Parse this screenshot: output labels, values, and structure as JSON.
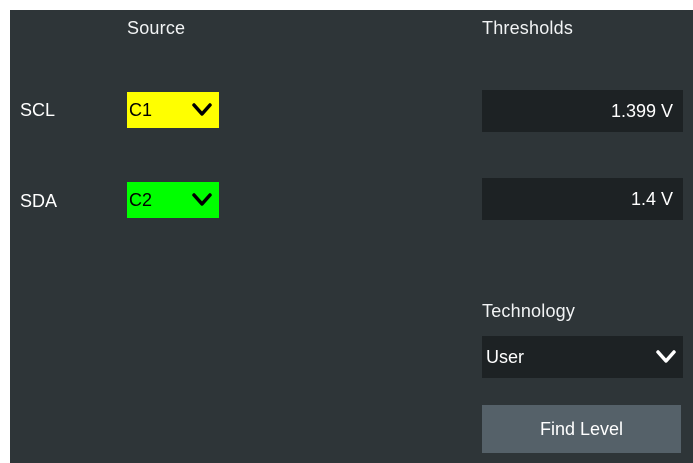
{
  "headers": {
    "source": "Source",
    "thresholds": "Thresholds",
    "technology": "Technology"
  },
  "rows": [
    {
      "label": "SCL",
      "source": "C1",
      "source_color": "#ffff00",
      "threshold": "1.399 V"
    },
    {
      "label": "SDA",
      "source": "C2",
      "source_color": "#00ff00",
      "threshold": "1.4 V"
    }
  ],
  "technology": {
    "value": "User"
  },
  "buttons": {
    "find_level": "Find Level"
  },
  "colors": {
    "panel_bg": "#2e3538",
    "field_bg": "#1d2224",
    "button_bg": "#556169"
  },
  "icons": {
    "dropdown": "chevron-down-icon"
  }
}
